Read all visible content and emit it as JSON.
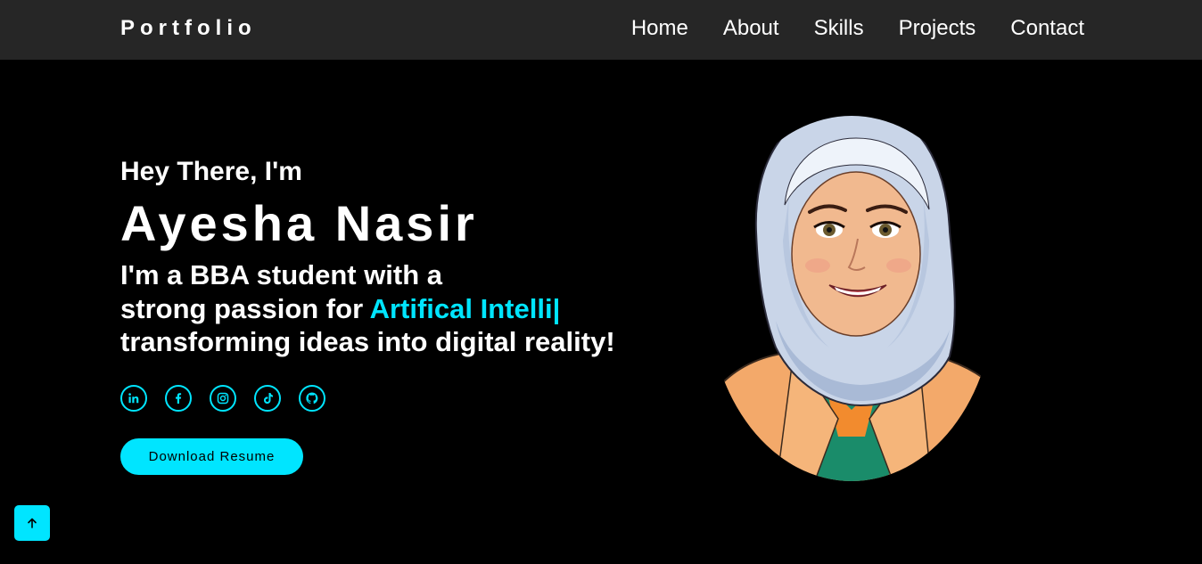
{
  "nav": {
    "brand": "Portfolio",
    "links": [
      "Home",
      "About",
      "Skills",
      "Projects",
      "Contact"
    ]
  },
  "hero": {
    "greeting": "Hey There, I'm",
    "name": "Ayesha Nasir",
    "tagline_line1": "I'm a BBA student with a",
    "tagline_line2_prefix": "strong passion for ",
    "tagline_typed": "Artifical Intelli|",
    "tagline_line3": "transforming ideas into digital reality!",
    "resume_label": "Download Resume"
  },
  "socials": [
    "linkedin-icon",
    "facebook-icon",
    "instagram-icon",
    "tiktok-icon",
    "github-icon"
  ],
  "colors": {
    "accent": "#00e5ff",
    "navbar": "#262626",
    "background": "#000000"
  }
}
